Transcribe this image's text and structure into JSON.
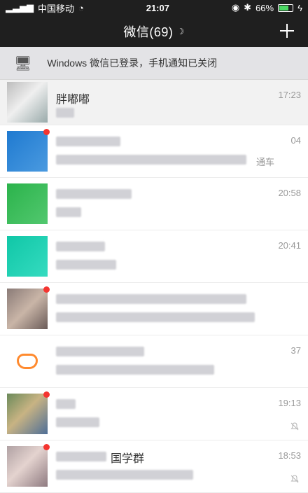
{
  "status": {
    "carrier": "中国移动",
    "time": "21:07",
    "battery": "66%",
    "battery_level": 0.66
  },
  "header": {
    "title": "微信(69)"
  },
  "notice": {
    "text": "Windows 微信已登录，手机通知已关闭"
  },
  "chats": [
    {
      "name": "胖嘟嘟",
      "time": "17:23",
      "snippet": ""
    },
    {
      "name": "",
      "time": "04",
      "snippet": "通车"
    },
    {
      "name": "",
      "time": "20:58",
      "snippet": ""
    },
    {
      "name": "",
      "time": "20:41",
      "snippet": ""
    },
    {
      "name": "",
      "time": "",
      "snippet": ""
    },
    {
      "name": "",
      "time": "37",
      "snippet": ""
    },
    {
      "name": "",
      "time": "19:13",
      "snippet": ""
    },
    {
      "name": "国学群",
      "time": "18:53",
      "snippet": ""
    }
  ]
}
